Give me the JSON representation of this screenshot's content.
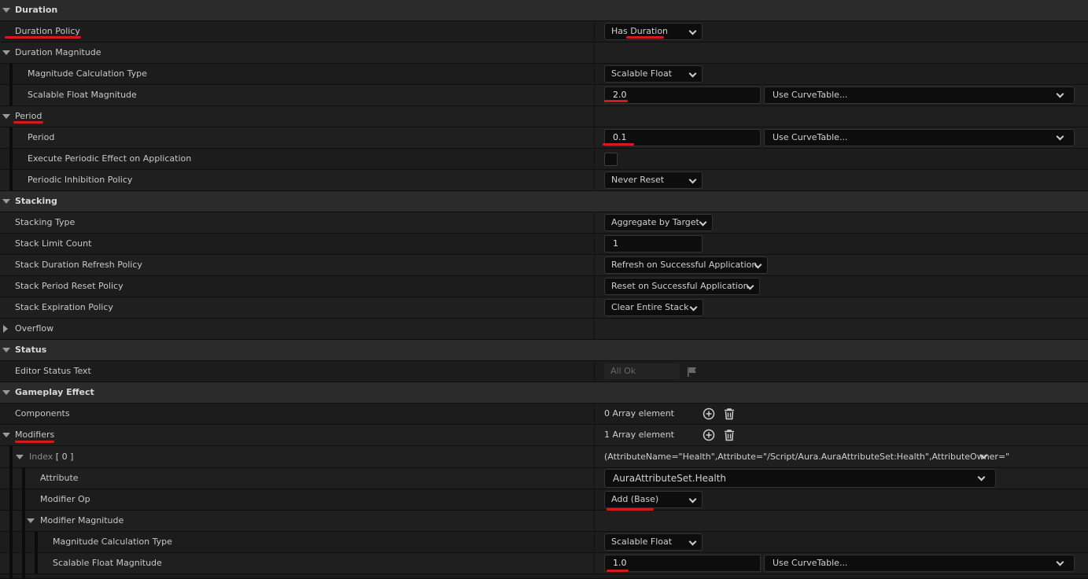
{
  "sections": {
    "duration": "Duration",
    "stacking": "Stacking",
    "status": "Status",
    "gameplay_effect": "Gameplay Effect"
  },
  "duration": {
    "policy_label": "Duration Policy",
    "policy_value": "Has Duration",
    "magnitude_label": "Duration Magnitude",
    "calc_type_label": "Magnitude Calculation Type",
    "calc_type_value": "Scalable Float",
    "scalable_label": "Scalable Float Magnitude",
    "scalable_value": "2.0",
    "curve_label": "Use CurveTable..."
  },
  "period": {
    "group_label": "Period",
    "period_label": "Period",
    "period_value": "0.1",
    "curve_label": "Use CurveTable...",
    "execute_label": "Execute Periodic Effect on Application",
    "execute_checked": false,
    "inhibition_label": "Periodic Inhibition Policy",
    "inhibition_value": "Never Reset"
  },
  "stacking": {
    "type_label": "Stacking Type",
    "type_value": "Aggregate by Target",
    "limit_label": "Stack Limit Count",
    "limit_value": "1",
    "refresh_label": "Stack Duration Refresh Policy",
    "refresh_value": "Refresh on Successful Application",
    "reset_label": "Stack Period Reset Policy",
    "reset_value": "Reset on Successful Application",
    "expiration_label": "Stack Expiration Policy",
    "expiration_value": "Clear Entire Stack",
    "overflow_label": "Overflow"
  },
  "status": {
    "editor_label": "Editor Status Text",
    "editor_value": "All Ok"
  },
  "gameplay_effect": {
    "components_label": "Components",
    "components_value": "0 Array element",
    "modifiers_label": "Modifiers",
    "modifiers_value": "1 Array element",
    "index_label": "Index",
    "index_value": "[ 0 ]",
    "index_summary": "(AttributeName=\"Health\",Attribute=\"/Script/Aura.AuraAttributeSet:Health\",AttributeOwner=\"",
    "attribute_label": "Attribute",
    "attribute_value": "AuraAttributeSet.Health",
    "modop_label": "Modifier Op",
    "modop_value": "Add (Base)",
    "mod_magnitude_label": "Modifier Magnitude",
    "calc_type_label": "Magnitude Calculation Type",
    "calc_type_value": "Scalable Float",
    "scalable_label": "Scalable Float Magnitude",
    "scalable_value": "1.0",
    "curve_label": "Use CurveTable..."
  },
  "colors": {
    "annotation": "#d41a1a",
    "category_bg": "#2b2b2b",
    "row_bg": "#1f1f1f"
  },
  "icons": [
    "expand-triangle-icon",
    "collapse-triangle-icon",
    "dropdown-chevron-icon",
    "flag-icon",
    "add-element-icon",
    "trash-icon"
  ]
}
